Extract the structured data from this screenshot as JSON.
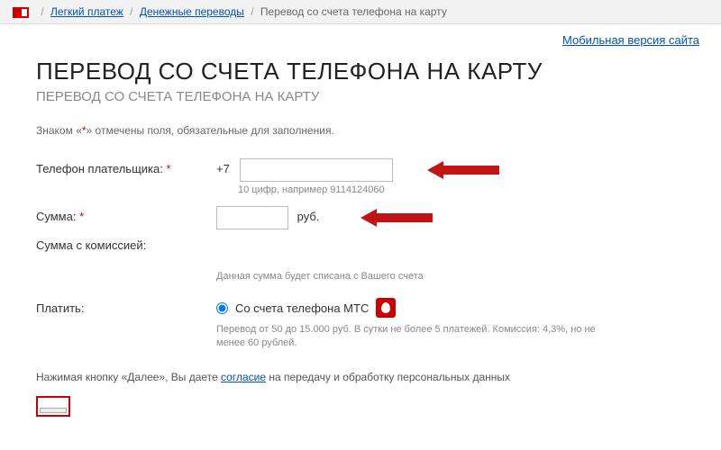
{
  "breadcrumb": {
    "link1": "Легкий платеж",
    "link2": "Денежные переводы",
    "current": "Перевод со счета телефона на карту"
  },
  "mobile_link": "Мобильная версия сайта",
  "title": "ПЕРЕВОД СО СЧЕТА ТЕЛЕФОНА НА КАРТУ",
  "subtitle": "ПЕРЕВОД СО СЧЕТА ТЕЛЕФОНА НА КАРТУ",
  "required_hint_pre": "Знаком «",
  "required_hint_mark": "*",
  "required_hint_post": "» отмечены поля, обязательные для заполнения.",
  "phone": {
    "label": "Телефон плательщика:",
    "prefix": "+7",
    "value": "",
    "hint": "10 цифр, например 9114124060"
  },
  "amount": {
    "label": "Сумма:",
    "value": "",
    "currency": "руб."
  },
  "amount_with_fee_label": "Сумма с комиссией:",
  "debit_note": "Данная сумма будет списана с Вашего счета",
  "pay": {
    "label": "Платить:",
    "option": "Со счета телефона МТС",
    "note": "Перевод от 50 до 15.000 руб. В сутки не более 5 платежей. Комиссия: 4,3%, но не менее 60 рублей."
  },
  "consent_pre": "Нажимая кнопку «Далее», Вы даете ",
  "consent_link": "согласие",
  "consent_post": " на передачу и обработку персональных данных"
}
